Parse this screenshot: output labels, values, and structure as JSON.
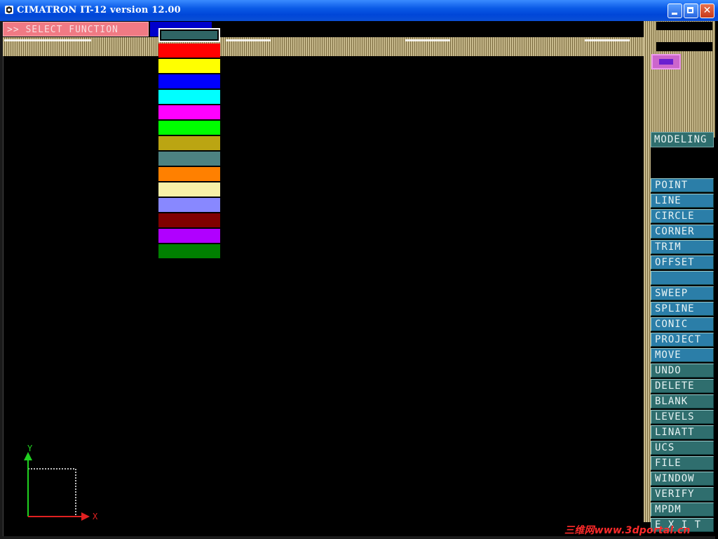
{
  "window": {
    "title": "CIMATRON IT-12 version 12.00",
    "controls": {
      "minimize": "",
      "maximize": "",
      "close": "✕"
    }
  },
  "header": {
    "prompt": ">> SELECT FUNCTION"
  },
  "palette": {
    "colors": [
      "#2f6565",
      "#ff0000",
      "#ffff00",
      "#0000ff",
      "#00ffff",
      "#ff00ff",
      "#00ff00",
      "#bba512",
      "#4d8282",
      "#ff8000",
      "#f7f0a7",
      "#8888ff",
      "#800000",
      "#b000ff",
      "#008000"
    ],
    "selected_index": 0
  },
  "menu": {
    "title": "MODELING",
    "items": [
      {
        "label": "POINT",
        "style": "blue"
      },
      {
        "label": "LINE",
        "style": "blue"
      },
      {
        "label": "CIRCLE",
        "style": "blue"
      },
      {
        "label": "CORNER",
        "style": "blue"
      },
      {
        "label": "TRIM",
        "style": "blue"
      },
      {
        "label": "OFFSET",
        "style": "blue"
      },
      {
        "label": "",
        "style": "blue"
      },
      {
        "label": "SWEEP",
        "style": "blue"
      },
      {
        "label": "SPLINE",
        "style": "blue"
      },
      {
        "label": "CONIC",
        "style": "blue"
      },
      {
        "label": "PROJECT",
        "style": "blue"
      },
      {
        "label": "MOVE",
        "style": "blue"
      },
      {
        "label": "UNDO",
        "style": "teal"
      },
      {
        "label": "DELETE",
        "style": "teal"
      },
      {
        "label": "BLANK",
        "style": "teal"
      },
      {
        "label": "LEVELS",
        "style": "teal"
      },
      {
        "label": "LINATT",
        "style": "teal"
      },
      {
        "label": "UCS",
        "style": "teal"
      },
      {
        "label": "FILE",
        "style": "teal"
      },
      {
        "label": "WINDOW",
        "style": "teal"
      },
      {
        "label": "VERIFY",
        "style": "teal"
      },
      {
        "label": "MPDM",
        "style": "teal"
      },
      {
        "label": "E X I T",
        "style": "teal"
      }
    ]
  },
  "axes": {
    "x_label": "X",
    "y_label": "Y",
    "x_color": "#e02020",
    "y_color": "#20d020"
  },
  "watermark": "三维网www.3dportal.cn"
}
